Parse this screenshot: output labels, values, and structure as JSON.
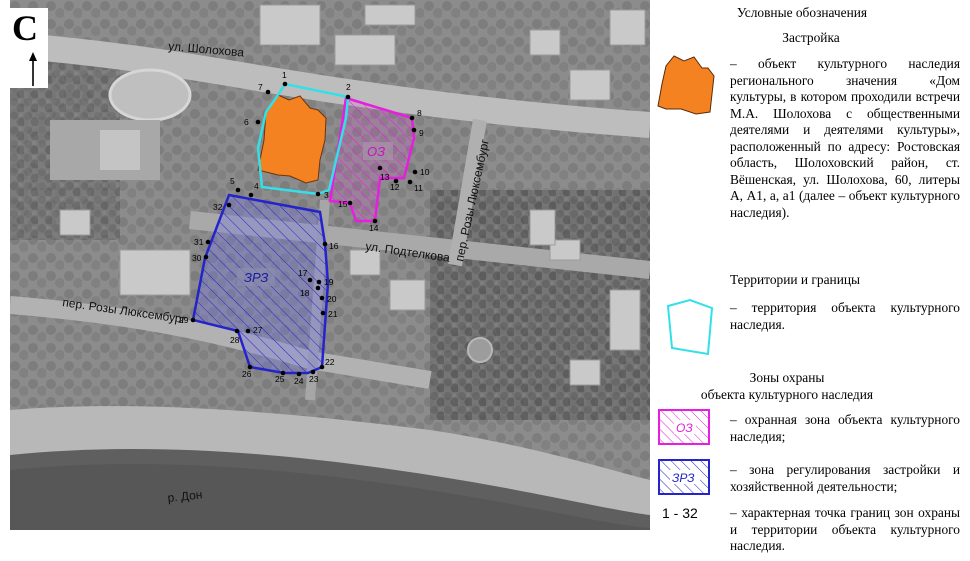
{
  "north": {
    "letter": "С"
  },
  "map": {
    "streets": [
      {
        "id": "sholokhova",
        "label": "ул. Шолохова"
      },
      {
        "id": "podtelkova",
        "label": "ул. Подтелкова"
      },
      {
        "id": "rozy_vert",
        "label": "пер. Розы Люксембург"
      },
      {
        "id": "rozy_vert2",
        "label": "пер. Розы Люксембург"
      },
      {
        "id": "rozy_horiz",
        "label": "пер. Розы Люксембург"
      },
      {
        "id": "don",
        "label": "р. Дон"
      }
    ],
    "zone_labels": {
      "oz": "ОЗ",
      "zrz": "ЗРЗ"
    },
    "points": [
      "1",
      "2",
      "3",
      "4",
      "5",
      "6",
      "7",
      "8",
      "9",
      "10",
      "11",
      "12",
      "13",
      "14",
      "15",
      "16",
      "17",
      "18",
      "19",
      "20",
      "21",
      "22",
      "23",
      "24",
      "25",
      "26",
      "27",
      "28",
      "29",
      "30",
      "31",
      "32"
    ]
  },
  "legend": {
    "title": "Условные обозначения",
    "building_heading": "Застройка",
    "building_text": "– объект культурного наследия регионального значения «Дом культуры, в котором проходили встречи М.А. Шолохова с общественными деятелями и деятелями культуры», расположенный по адресу: Ростовская область, Шолоховский район, ст. Вёшенская, ул. Шолохова, 60, литеры А, А1, а, а1 (далее – объект культурного наследия).",
    "territory_heading": "Территории и границы",
    "territory_text": "– территория объекта культурного наследия.",
    "zones_heading": "Зоны охраны\nобъекта культурного наследия",
    "oz_sym_label": "ОЗ",
    "oz_text": "– охранная зона объекта культурного наследия;",
    "zrz_sym_label": "ЗРЗ",
    "zrz_text": "– зона регулирования застройки и хозяйственной деятельности;",
    "range_label": "1 - 32",
    "points_text": "– характерная точка границ зон охраны и территории объекта культурного наследия."
  },
  "colors": {
    "heritage": "#f58220",
    "territory": "#33e0e8",
    "oz": "#e61ee0",
    "zrz": "#2424c8"
  }
}
